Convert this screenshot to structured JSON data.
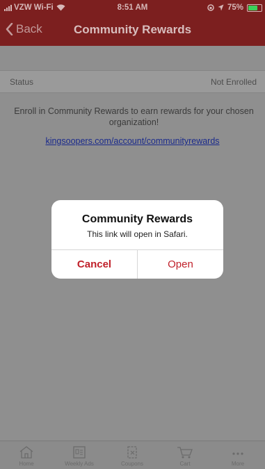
{
  "status_bar": {
    "carrier": "VZW Wi-Fi",
    "time": "8:51 AM",
    "battery": "75%"
  },
  "nav": {
    "back_label": "Back",
    "title": "Community Rewards"
  },
  "content": {
    "status_label": "Status",
    "status_value": "Not Enrolled",
    "info_text": "Enroll in Community Rewards to earn rewards for your chosen organization!",
    "link_text": "kingsoopers.com/account/communityrewards"
  },
  "dialog": {
    "title": "Community Rewards",
    "message": "This link will open in Safari.",
    "cancel_label": "Cancel",
    "open_label": "Open",
    "accent": "#c0202a"
  },
  "tabbar": {
    "items": [
      {
        "label": "Home",
        "icon": "home-icon"
      },
      {
        "label": "Weekly Ads",
        "icon": "weekly-ads-icon"
      },
      {
        "label": "Coupons",
        "icon": "coupon-icon"
      },
      {
        "label": "Cart",
        "icon": "cart-icon"
      },
      {
        "label": "More",
        "icon": "more-icon"
      }
    ]
  },
  "colors": {
    "header": "#7c1f1f",
    "overlay": "#8f8f8f"
  }
}
